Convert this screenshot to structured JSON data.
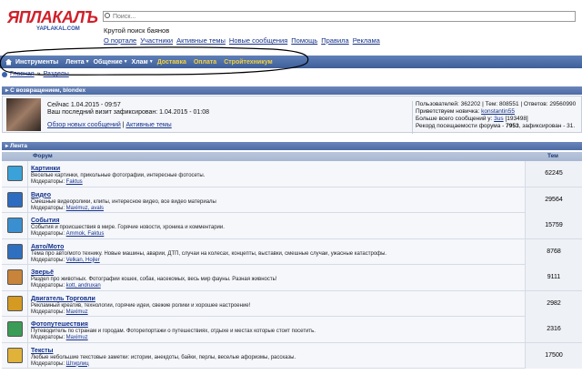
{
  "logo": {
    "main": "ЯПЛАКАЛЪ",
    "sub": "YAPLAKAL.COM"
  },
  "search": {
    "placeholder": "Поиск..."
  },
  "tagline": "Крутой поиск баянов",
  "toplinks": [
    "О портале",
    "Участники",
    "Активные темы",
    "Новые сообщения",
    "Помощь",
    "Правила",
    "Реклама"
  ],
  "nav": [
    "Инструменты",
    "Лента",
    "Общение",
    "Хлам",
    "Доставка",
    "Оплата",
    "Стройтехникум"
  ],
  "nav_colors": {
    "highlight": "#f5d23b",
    "bar": "#4b6ba7"
  },
  "breadcrumb": [
    "Главная",
    "Разделы"
  ],
  "welcome_bar": "С возвращением, blondex",
  "welcome": {
    "now": "Сейчас 1.04.2015 - 09:57",
    "last": "Ваш последний визит зафиксирован: 1.04.2015 - 01:08",
    "link1": "Обзор новых сообщений",
    "link2": "Активные темы"
  },
  "stats": {
    "line1": "Пользователей: 362202 | Тем: 808551 | Ответов: 29560990",
    "line2_prefix": "Приветствуем новичка:",
    "line2_user": "konstantin55",
    "line3_prefix": "Больше всего сообщений у:",
    "line3_user": "3us",
    "line3_suffix": "[193498]",
    "line4_prefix": "Рекорд посещаемости форума -",
    "line4_value": "7953",
    "line4_suffix": ", зафиксирован - 31."
  },
  "feed_bar": "Лента",
  "table": {
    "col_forum": "Форум",
    "col_topics": "Тем"
  },
  "forums": [
    {
      "title": "Картинки",
      "desc": "Веселые картинки, прикольные фотографии, интересные фотосеты.",
      "mods_label": "Модераторы:",
      "mods": "Faktus",
      "count": "62245",
      "icon_color": "#3aa2d8"
    },
    {
      "title": "Видео",
      "desc": "Смешные видеоролики, клипы, интересное видео, все видео материалы",
      "mods_label": "Модераторы:",
      "mods": "Maximuz, avals",
      "count": "29564",
      "icon_color": "#2d6cc0"
    },
    {
      "title": "События",
      "desc": "События и происшествия в мире. Горячие новости, хроника и комментарии.",
      "mods_label": "Модераторы:",
      "mods": "Ammok, Faktus",
      "count": "15759",
      "icon_color": "#3a8fd0"
    },
    {
      "title": "Авто/Мото",
      "desc": "Тема про авто/мото технику. Новые машины, аварии, ДТП, случаи на колесах, концепты, выставки, смешные случаи, ужасные катастрофы.",
      "mods_label": "Модераторы:",
      "mods": "Velkan, Hojler",
      "count": "8768",
      "icon_color": "#2f6fbf"
    },
    {
      "title": "Зверьё",
      "desc": "Раздел про животных. Фотографии кошек, собак, насекомых, весь мир фауны. Разная живность!",
      "mods_label": "Модераторы:",
      "mods": "kott, andruxan",
      "count": "9111",
      "icon_color": "#c7843a"
    },
    {
      "title": "Двигатель Торговли",
      "desc": "Рекламный креатив, технологии, горячие идеи, свежие ролики и хорошее настроение!",
      "mods_label": "Модераторы:",
      "mods": "Maximuz",
      "count": "2982",
      "icon_color": "#d49a22"
    },
    {
      "title": "Фотопутешествия",
      "desc": "Путеводитель по странам и городам. Фоторепортажи о путешествиях, отдыхе и местах которые стоит посетить.",
      "mods_label": "Модераторы:",
      "mods": "Maximuz",
      "count": "2316",
      "icon_color": "#3b9c58"
    },
    {
      "title": "Тексты",
      "desc": "Любые небольшие текстовые заметки: истории, анекдоты, байки, перлы, веселые афоризмы, рассказы.",
      "mods_label": "Модераторы:",
      "mods": "Штирлиц",
      "count": "17500",
      "icon_color": "#e0b23a"
    }
  ]
}
